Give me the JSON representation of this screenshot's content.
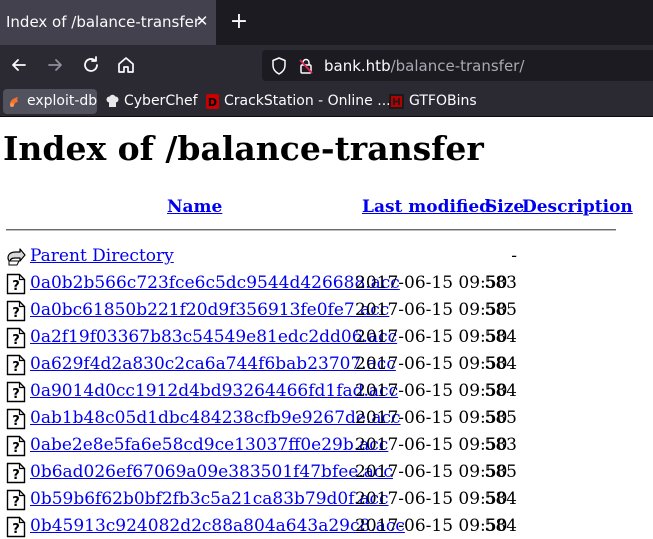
{
  "browser": {
    "tab": {
      "title": "Index of /balance-transfer",
      "close_glyph": "✕"
    },
    "new_tab_glyph": "+",
    "nav": {
      "back_icon": "arrow-left-icon",
      "forward_icon": "arrow-right-icon",
      "reload_icon": "reload-icon",
      "home_icon": "home-icon"
    },
    "url": {
      "host": "bank.htb",
      "path": "/balance-transfer/"
    },
    "bookmarks": [
      {
        "label": "exploit-db",
        "icon": "exploit-db-icon",
        "color": "#f4722b"
      },
      {
        "label": "CyberChef",
        "icon": "chef-hat-icon",
        "color": "#e8e8ea"
      },
      {
        "label": "CrackStation - Online ...",
        "icon": "crackstation-icon",
        "color": "#c90000"
      },
      {
        "label": "GTFOBins",
        "icon": "gtfobins-icon",
        "color": "#b30000"
      }
    ]
  },
  "page": {
    "title": "Index of /balance-transfer",
    "columns": {
      "name": "Name",
      "modified": "Last modified",
      "size": "Size",
      "description": "Description"
    },
    "parent": {
      "name": "Parent Directory",
      "size": "-"
    },
    "files": [
      {
        "name": "0a0b2b566c723fce6c5dc9544d426688.acc",
        "modified": "2017-06-15 09:50",
        "size": "583"
      },
      {
        "name": "0a0bc61850b221f20d9f356913fe0fe7.acc",
        "modified": "2017-06-15 09:50",
        "size": "585"
      },
      {
        "name": "0a2f19f03367b83c54549e81edc2dd06.acc",
        "modified": "2017-06-15 09:50",
        "size": "584"
      },
      {
        "name": "0a629f4d2a830c2ca6a744f6bab23707.acc",
        "modified": "2017-06-15 09:50",
        "size": "584"
      },
      {
        "name": "0a9014d0cc1912d4bd93264466fd1fad.acc",
        "modified": "2017-06-15 09:50",
        "size": "584"
      },
      {
        "name": "0ab1b48c05d1dbc484238cfb9e9267de.acc",
        "modified": "2017-06-15 09:50",
        "size": "585"
      },
      {
        "name": "0abe2e8e5fa6e58cd9ce13037ff0e29b.acc",
        "modified": "2017-06-15 09:50",
        "size": "583"
      },
      {
        "name": "0b6ad026ef67069a09e383501f47bfee.acc",
        "modified": "2017-06-15 09:50",
        "size": "585"
      },
      {
        "name": "0b59b6f62b0bf2fb3c5a21ca83b79d0f.acc",
        "modified": "2017-06-15 09:50",
        "size": "584"
      },
      {
        "name": "0b45913c924082d2c88a804a643a29c8.acc",
        "modified": "2017-06-15 09:50",
        "size": "584"
      }
    ]
  }
}
